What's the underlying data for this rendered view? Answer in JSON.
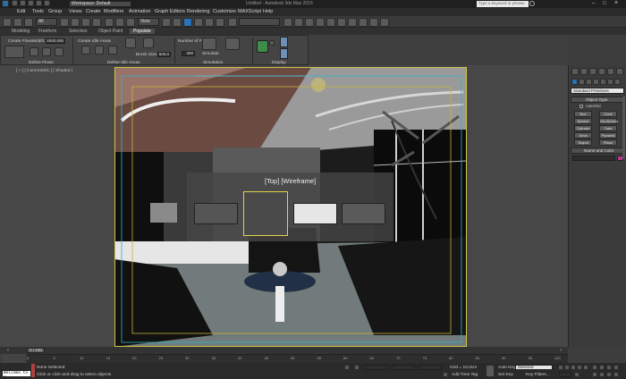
{
  "window": {
    "workspace": "Workspace: Default",
    "title": "Untitled - Autodesk 3ds Max 2016",
    "search_placeholder": "Type a keyword or phrase"
  },
  "menu": [
    "Edit",
    "Tools",
    "Group",
    "Views",
    "Create",
    "Modifiers",
    "Animation",
    "Graph Editors",
    "Rendering",
    "Customize",
    "MAXScript",
    "Help"
  ],
  "ribbon": {
    "tabs": [
      "Modeling",
      "Freeform",
      "Selection",
      "Object Paint",
      "Populate"
    ],
    "active_tab": "Populate",
    "create_flows": "Create Flows",
    "width_label": "Width:",
    "width_value": "2000,000",
    "create_idle_areas": "Create Idle Areas",
    "brush_size_label": "Brush Size:",
    "brush_size_value": "500,0",
    "number_of_frames_label": "Number of Frames:",
    "number_of_frames_value": "300",
    "simulate": "Simulate",
    "sections": [
      "Define Flows",
      "Define Idle Areas",
      "Simulation",
      "Display"
    ]
  },
  "viewport": {
    "label": "[ + ] [ Camera001 ] [ Shaded ]",
    "overlay_title": "[Top] [Wireframe]"
  },
  "command_panel": {
    "dropdown": "Standard Primitives",
    "object_type_title": "Object Type",
    "autogrid": "AutoGrid",
    "buttons": [
      "Box",
      "Cone",
      "Sphere",
      "GeoSphere",
      "Cylinder",
      "Tube",
      "Torus",
      "Pyramid",
      "Teapot",
      "Plane"
    ],
    "name_and_color": "Name and Color"
  },
  "timeline": {
    "frame_counter": "0 / 100",
    "ticks": [
      "0",
      "5",
      "10",
      "15",
      "20",
      "25",
      "30",
      "35",
      "40",
      "45",
      "50",
      "55",
      "60",
      "65",
      "70",
      "75",
      "80",
      "85",
      "90",
      "95",
      "100"
    ]
  },
  "status": {
    "listener": "Welcome to M",
    "selection": "None Selected",
    "prompt": "Click or click-and-drag to select objects",
    "grid": "Grid = 10,0cm",
    "add_time_tag": "Add Time Tag",
    "auto_key": "Auto Key",
    "selected": "Selected",
    "set_key": "Set Key",
    "key_filters": "Key Filters..."
  }
}
